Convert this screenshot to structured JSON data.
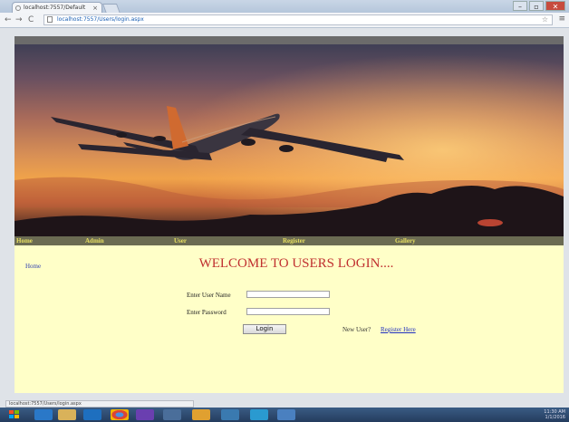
{
  "browser": {
    "tab_title": "localhost:7557/Default",
    "tab_close": "×",
    "back": "←",
    "forward": "→",
    "reload": "C",
    "address": "localhost:7557/Users/login.aspx",
    "window_controls": {
      "minimize": "–",
      "maximize": "▫",
      "close": "✕"
    }
  },
  "site": {
    "nav": [
      "Home",
      "Admin",
      "User",
      "Register",
      "Gallery"
    ],
    "home_link": "Home",
    "heading": "WELCOME TO USERS LOGIN....",
    "form": {
      "username_label": "Enter User Name",
      "password_label": "Enter Password",
      "login_button": "Login",
      "new_user_text": "New User?",
      "register_link": "Register Here"
    }
  },
  "status_bar": "localhost:7557/Users/login.aspx",
  "taskbar": {
    "icons": [
      "start",
      "ie",
      "explorer",
      "outlook",
      "chrome",
      "visual-studio",
      "paint",
      "folder",
      "media",
      "network",
      "vs-code"
    ],
    "tray_time": "11:30 AM",
    "tray_date": "1/1/2016"
  },
  "colors": {
    "heading": "#c03030",
    "nav_link": "#e8e060",
    "nav_bar": "#6b6b52",
    "page_bg": "#ffffc8"
  }
}
